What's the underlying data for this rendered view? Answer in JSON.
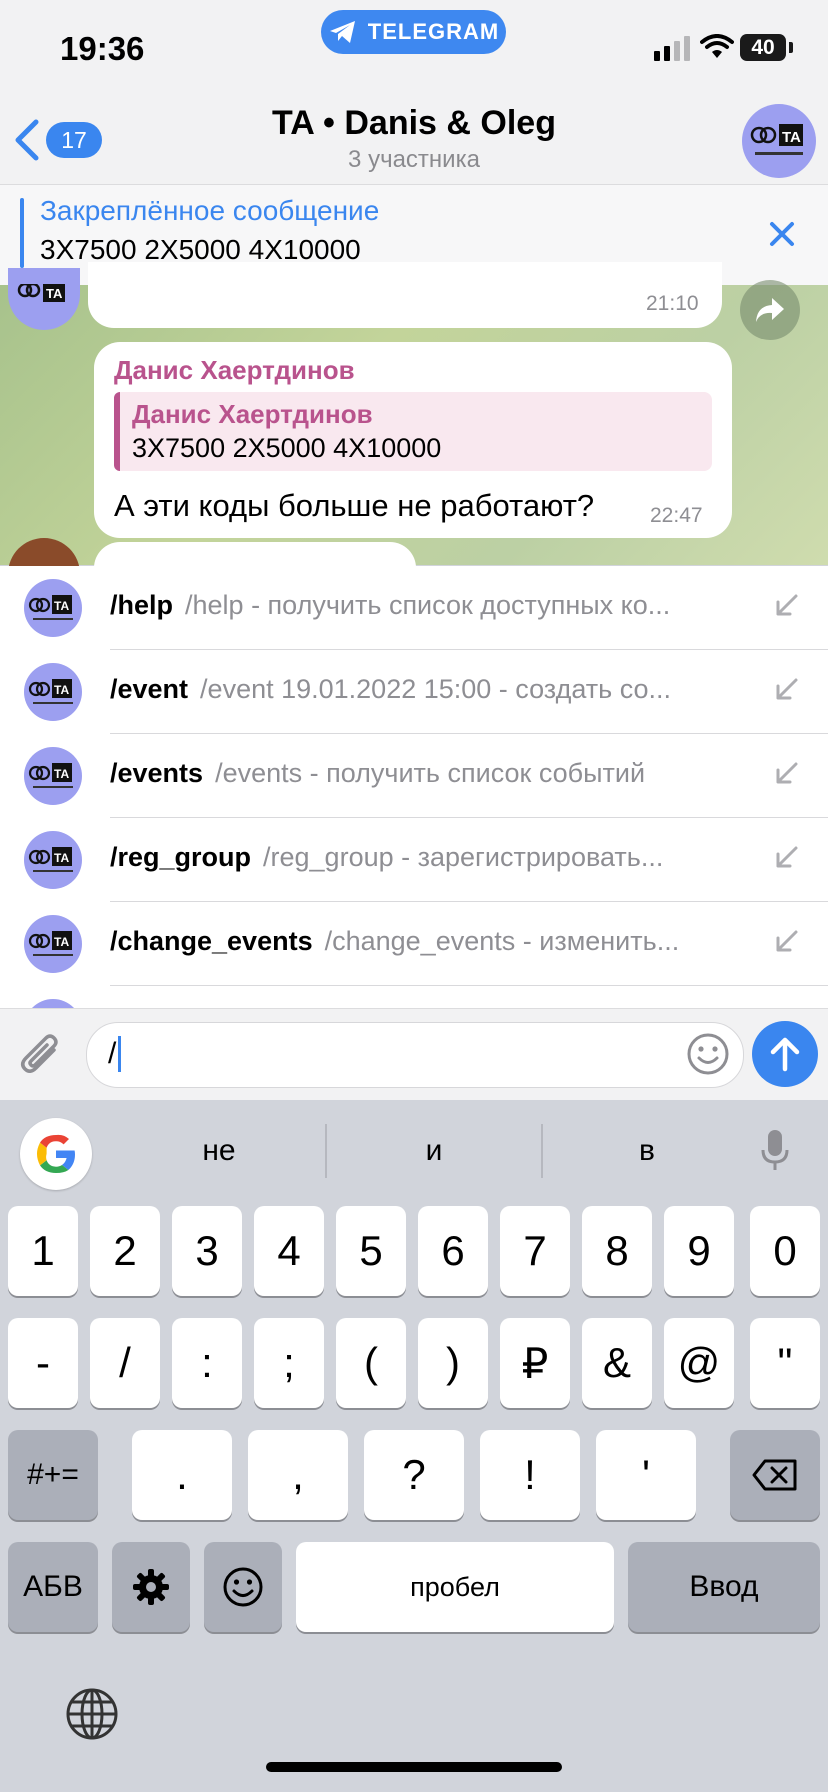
{
  "status_bar": {
    "time": "19:36",
    "source_app": "TELEGRAM",
    "battery": "40"
  },
  "header": {
    "back_count": "17",
    "title": "TA • Danis & Oleg",
    "subtitle": "3 участника",
    "avatar_text": "TA"
  },
  "pinned": {
    "title": "Закреплённое сообщение",
    "text": "3X7500 2X5000 4X10000"
  },
  "messages": [
    {
      "time": "21:10"
    },
    {
      "sender": "Данис Хаертдинов",
      "reply_sender": "Данис Хаертдинов",
      "reply_text": "3X7500 2X5000 4X10000",
      "text": "А эти коды больше не работают?",
      "time": "22:47"
    }
  ],
  "commands": [
    {
      "name": "/help",
      "desc": "/help - получить список доступных ко..."
    },
    {
      "name": "/event",
      "desc": "/event 19.01.2022 15:00 - создать со..."
    },
    {
      "name": "/events",
      "desc": "/events - получить список событий"
    },
    {
      "name": "/reg_group",
      "desc": "/reg_group - зарегистрировать..."
    },
    {
      "name": "/change_events",
      "desc": "/change_events - изменить..."
    }
  ],
  "input": {
    "value": "/"
  },
  "keyboard": {
    "suggestions": [
      "не",
      "и",
      "в"
    ],
    "row1": [
      "1",
      "2",
      "3",
      "4",
      "5",
      "6",
      "7",
      "8",
      "9",
      "0"
    ],
    "row2": [
      "-",
      "/",
      ":",
      ";",
      "(",
      ")",
      "₽",
      "&",
      "@",
      "\""
    ],
    "row3_mode": "#+=",
    "row3": [
      ".",
      ",",
      "?",
      "!",
      "'"
    ],
    "abc": "АБВ",
    "space": "пробел",
    "enter": "Ввод"
  },
  "colors": {
    "accent": "#3a86ef",
    "sender": "#b9538d",
    "avatar": "#9c9ff0"
  }
}
